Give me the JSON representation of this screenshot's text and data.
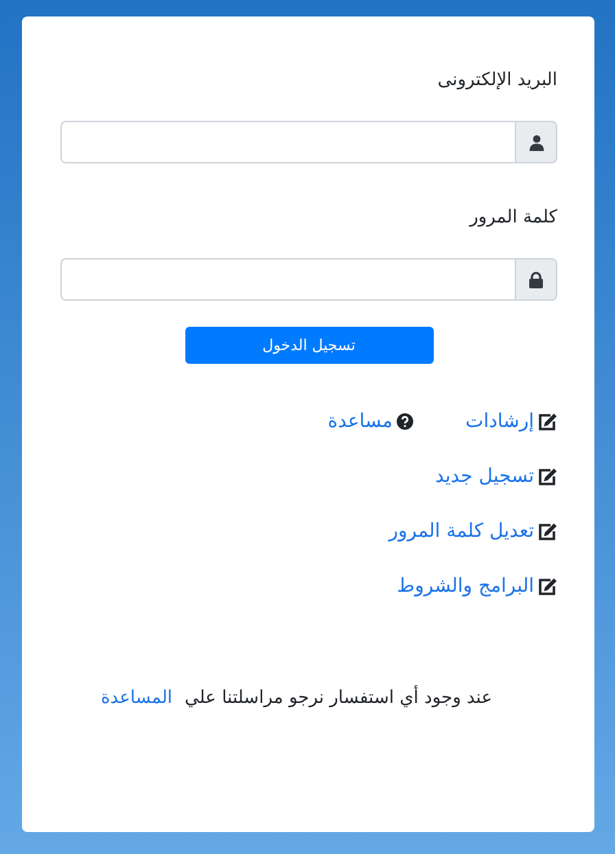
{
  "form": {
    "email_label": "البريد الإلكترونى",
    "password_label": "كلمة المرور",
    "submit": "تسجيل الدخول"
  },
  "link_rows": [
    [
      {
        "label": "إرشادات",
        "kind": "edit"
      },
      {
        "label": "مساعدة",
        "kind": "help"
      }
    ],
    [
      {
        "label": "تسجيل جديد",
        "kind": "edit"
      }
    ],
    [
      {
        "label": "تعديل كلمة المرور",
        "kind": "edit"
      }
    ],
    [
      {
        "label": "البرامج والشروط",
        "kind": "edit"
      }
    ]
  ],
  "footer": {
    "text": "عند وجود أي استفسار نرجو مراسلتنا علي",
    "link": "المساعدة"
  }
}
